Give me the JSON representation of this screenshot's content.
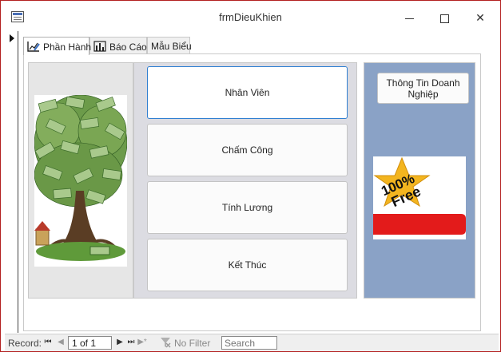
{
  "window": {
    "title": "frmDieuKhien"
  },
  "tabs": [
    {
      "label": "Phần Hành",
      "icon": "edit-chart-icon",
      "active": true
    },
    {
      "label": "Báo Cáo",
      "icon": "bar-chart-icon",
      "active": false
    },
    {
      "label": "Mẫu Biểu",
      "icon": "",
      "active": false
    }
  ],
  "menu": {
    "buttons": [
      {
        "label": "Nhân Viên"
      },
      {
        "label": "Chấm Công"
      },
      {
        "label": "Tính Lương"
      },
      {
        "label": "Kết Thúc"
      }
    ]
  },
  "side": {
    "info_button": "Thông Tin Doanh Nghiệp",
    "badge_line1": "100%",
    "badge_line2": "Free"
  },
  "record_bar": {
    "label": "Record:",
    "current": "1 of 1",
    "filter_label": "No Filter",
    "search_placeholder": "Search"
  },
  "colors": {
    "window_border": "#b32020",
    "focus_border": "#2f7fd1",
    "right_panel": "#8aa2c6",
    "middle_panel": "#dcdce2",
    "left_panel": "#e6e6e6"
  }
}
